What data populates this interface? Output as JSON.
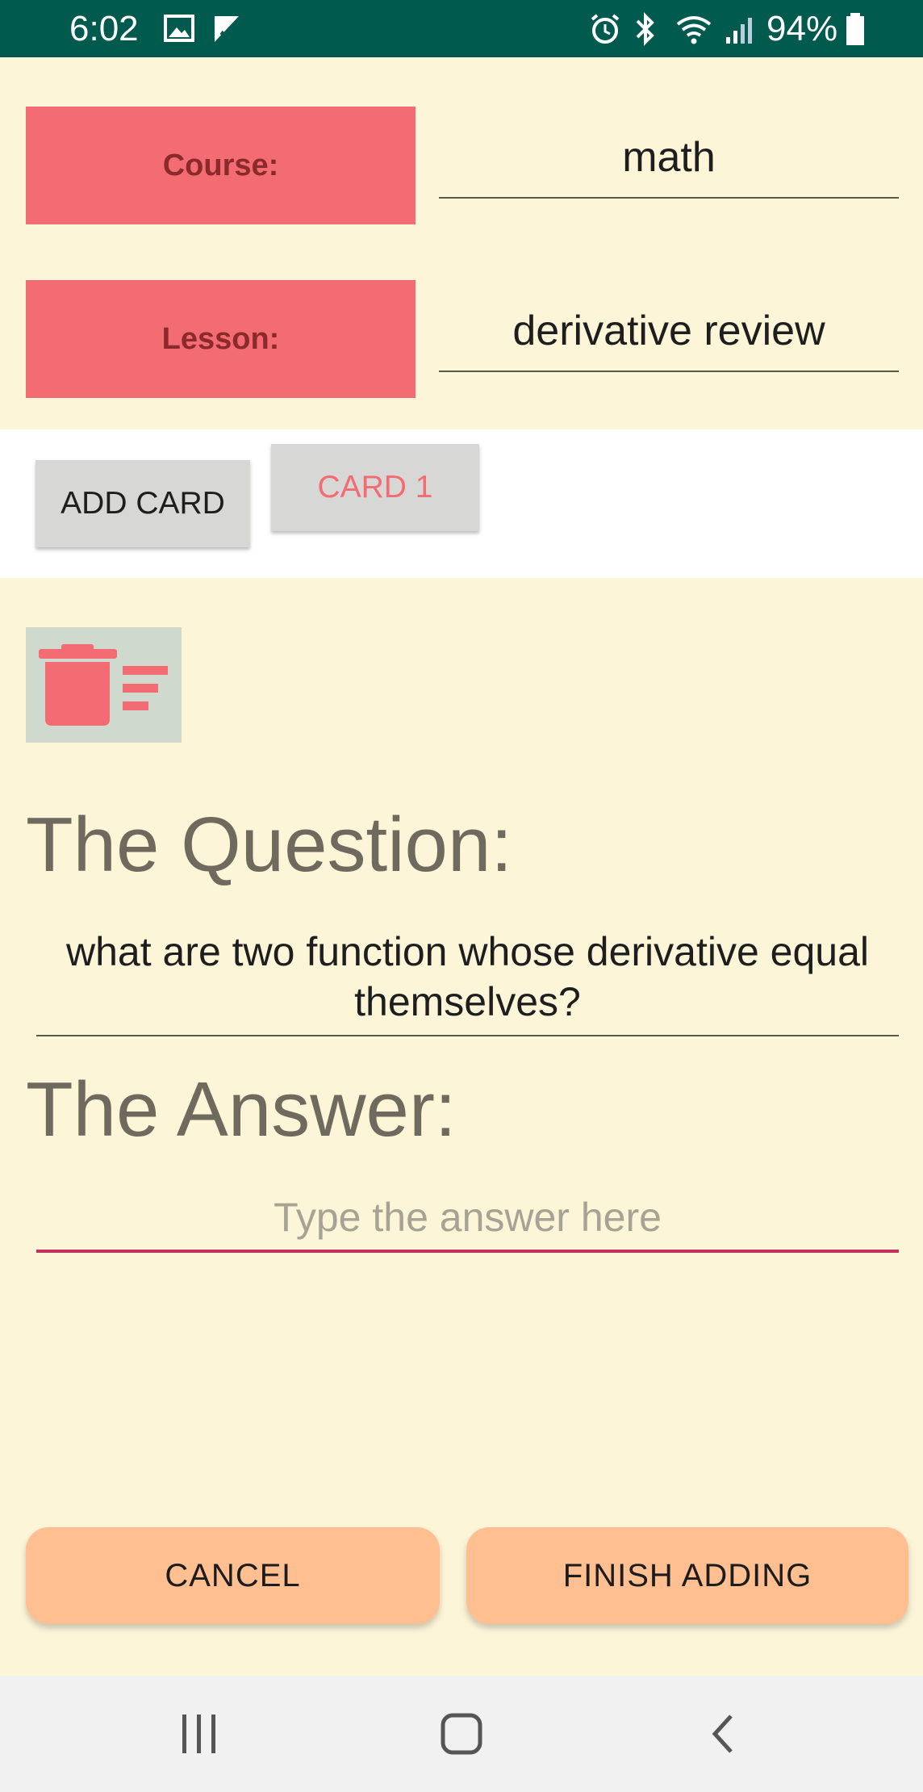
{
  "status_bar": {
    "time": "6:02",
    "battery": "94%",
    "icons": [
      "image-icon",
      "check-icon",
      "alarm-icon",
      "bluetooth-icon",
      "wifi-icon",
      "signal-icon",
      "battery-icon"
    ]
  },
  "course": {
    "label": "Course:",
    "value": "math"
  },
  "lesson": {
    "label": "Lesson:",
    "value": "derivative review"
  },
  "cards": {
    "add_label": "ADD CARD",
    "items": [
      "CARD 1"
    ]
  },
  "question": {
    "heading": "The Question:",
    "text": "what are two function whose derivative equal themselves?"
  },
  "answer": {
    "heading": "The Answer:",
    "placeholder": "Type the answer here"
  },
  "actions": {
    "cancel": "CANCEL",
    "finish": "FINISH ADDING"
  },
  "colors": {
    "accent": "#f36b73",
    "background": "#fdf5d8",
    "status_bar": "#005a4e",
    "button_orange": "#ffbf90",
    "focus_underline": "#c2325c"
  }
}
